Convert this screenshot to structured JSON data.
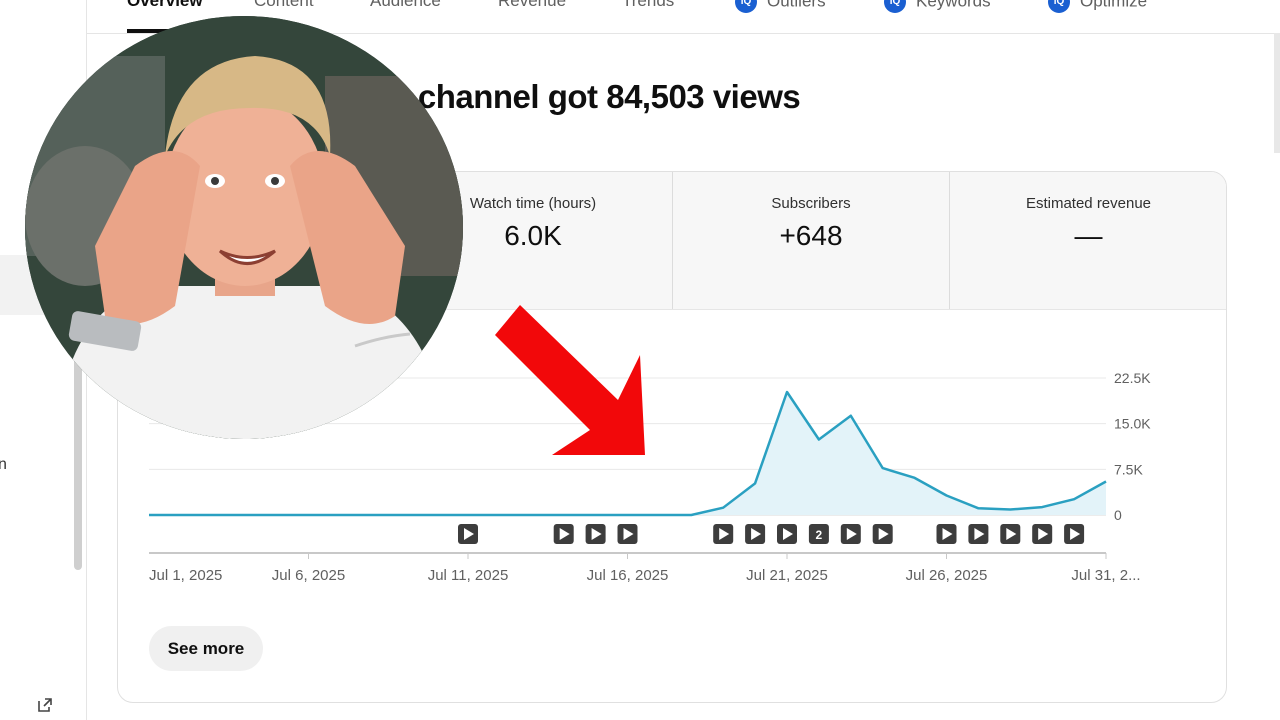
{
  "tabs": [
    {
      "label": "Overview",
      "active": true,
      "badge": false
    },
    {
      "label": "Content",
      "active": false,
      "badge": false
    },
    {
      "label": "Audience",
      "active": false,
      "badge": false
    },
    {
      "label": "Revenue",
      "active": false,
      "badge": false
    },
    {
      "label": "Trends",
      "active": false,
      "badge": false
    },
    {
      "label": "Outliers",
      "active": false,
      "badge": true
    },
    {
      "label": "Keywords",
      "active": false,
      "badge": true
    },
    {
      "label": "Optimize",
      "active": false,
      "badge": true
    }
  ],
  "tab_badge_text": "iQ",
  "headline": "cted period, your channel got 84,503 views",
  "metrics": [
    {
      "label": "Watch time (hours)",
      "value": "6.0K"
    },
    {
      "label": "Subscribers",
      "value": "+648"
    },
    {
      "label": "Estimated revenue",
      "value": "—"
    }
  ],
  "sidebar": {
    "partial_text": "n"
  },
  "see_more_label": "See more",
  "video_marker_badge": "2",
  "colors": {
    "line": "#2aa0c1",
    "fill": "#e3f3f9",
    "arrow": "#f2080a",
    "badge": "#1a5fd1"
  },
  "chart_data": {
    "type": "area",
    "x": [
      "Jul 1",
      "Jul 2",
      "Jul 3",
      "Jul 4",
      "Jul 5",
      "Jul 6",
      "Jul 7",
      "Jul 8",
      "Jul 9",
      "Jul 10",
      "Jul 11",
      "Jul 12",
      "Jul 13",
      "Jul 14",
      "Jul 15",
      "Jul 16",
      "Jul 17",
      "Jul 18",
      "Jul 19",
      "Jul 20",
      "Jul 21",
      "Jul 22",
      "Jul 23",
      "Jul 24",
      "Jul 25",
      "Jul 26",
      "Jul 27",
      "Jul 28",
      "Jul 29",
      "Jul 30",
      "Jul 31"
    ],
    "series": [
      {
        "values": [
          0,
          0,
          0,
          0,
          0,
          0,
          0,
          0,
          0,
          0,
          0,
          0,
          0,
          0,
          0,
          0,
          0,
          0,
          1200,
          5200,
          20200,
          12400,
          16300,
          7700,
          6100,
          3200,
          1100,
          900,
          1300,
          2600,
          5500
        ]
      }
    ],
    "xticks": [
      "Jul 1, 2025",
      "Jul 6, 2025",
      "Jul 11, 2025",
      "Jul 16, 2025",
      "Jul 21, 2025",
      "Jul 26, 2025",
      "Jul 31, 2..."
    ],
    "yticks": [
      "22.5K",
      "15.0K",
      "7.5K",
      "0"
    ],
    "ylim": [
      0,
      22500
    ],
    "grid": true,
    "video_markers": [
      {
        "day": 11
      },
      {
        "day": 14
      },
      {
        "day": 15
      },
      {
        "day": 16
      },
      {
        "day": 19
      },
      {
        "day": 20
      },
      {
        "day": 21
      },
      {
        "day": 22,
        "count": 2
      },
      {
        "day": 23
      },
      {
        "day": 24
      },
      {
        "day": 26
      },
      {
        "day": 27
      },
      {
        "day": 28
      },
      {
        "day": 29
      },
      {
        "day": 30
      }
    ]
  }
}
